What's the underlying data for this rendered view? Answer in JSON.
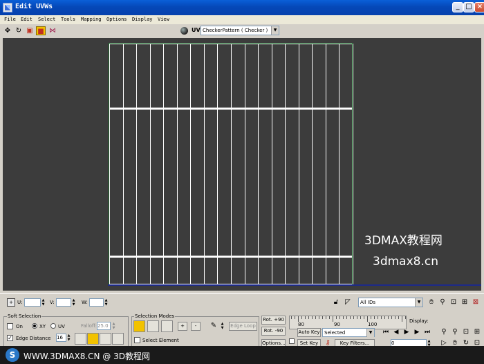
{
  "window": {
    "title": "Edit UVWs",
    "minimize": "_",
    "maximize": "□",
    "close": "×"
  },
  "menu": [
    "File",
    "Edit",
    "Select",
    "Tools",
    "Mapping",
    "Options",
    "Display",
    "View"
  ],
  "toolbar": {
    "tools": [
      {
        "name": "move-tool-icon",
        "glyph": "✥"
      },
      {
        "name": "rotate-tool-icon",
        "glyph": "↻"
      },
      {
        "name": "scale-tool-icon",
        "glyph": "▣"
      },
      {
        "name": "freeform-tool-icon",
        "glyph": "■"
      },
      {
        "name": "mirror-tool-icon",
        "glyph": "⋈"
      }
    ],
    "uv_label": "UV",
    "texture_dropdown": "CheckerPattern  ( Checker )"
  },
  "viewport": {
    "background": "#3c3c3c",
    "line_color": "#ffffff",
    "watermark_1": "3DMAX教程网",
    "watermark_2": "3dmax8.cn"
  },
  "coords": {
    "u_label": "U:",
    "v_label": "V:",
    "w_label": "W:",
    "ids_dropdown": "All IDs"
  },
  "soft_selection": {
    "title": "Soft Selection",
    "on_label": "On",
    "xy_label": "XY",
    "uv_label": "UV",
    "falloff_label": "Falloff:",
    "falloff_value": "25.0",
    "edge_distance_label": "Edge Distance",
    "edge_distance_value": "16"
  },
  "selection_modes": {
    "title": "Selection Modes",
    "plus": "+",
    "minus": "-",
    "edge_loop": "Edge Loop",
    "select_element": "Select Element"
  },
  "rotate": {
    "rot_plus_90": "Rot. +90",
    "rot_minus_90": "Rot. -90",
    "options": "Options..."
  },
  "timeline": {
    "ticks": [
      "80",
      "90",
      "100"
    ],
    "display_label": "Display:",
    "auto_key": "Auto Key",
    "selected": "Selected",
    "set_key": "Set Key",
    "key_filters": "Key Filters...",
    "frame": "0"
  },
  "footer": {
    "text": "WWW.3DMAX8.CN @ 3D教程网",
    "logo": "S"
  }
}
